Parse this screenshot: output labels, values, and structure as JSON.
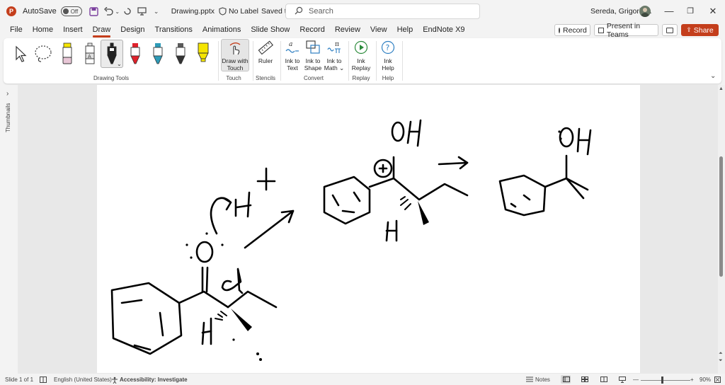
{
  "titlebar": {
    "autosave_label": "AutoSave",
    "autosave_state": "Off",
    "filename": "Drawing.pptx",
    "sensitivity": "No Label",
    "save_status": "Saved to this PC",
    "search_placeholder": "Search",
    "user_name": "Sereda, Grigoriy A"
  },
  "menu": {
    "tabs": [
      "File",
      "Home",
      "Insert",
      "Draw",
      "Design",
      "Transitions",
      "Animations",
      "Slide Show",
      "Record",
      "Review",
      "View",
      "Help",
      "EndNote X9"
    ],
    "active_tab": "Draw",
    "record_button": "Record",
    "present_button": "Present in Teams",
    "share_button": "Share"
  },
  "ribbon": {
    "groups": {
      "drawing_tools": "Drawing Tools",
      "touch": "Touch",
      "stencils": "Stencils",
      "convert": "Convert",
      "replay": "Replay",
      "help": "Help"
    },
    "draw_with_touch": [
      "Draw with",
      "Touch"
    ],
    "ruler": "Ruler",
    "ink_to_text": [
      "Ink to",
      "Text"
    ],
    "ink_to_shape": [
      "Ink to",
      "Shape"
    ],
    "ink_to_math": [
      "Ink to",
      "Math"
    ],
    "ink_replay": [
      "Ink",
      "Replay"
    ],
    "ink_help": [
      "Ink",
      "Help"
    ],
    "pen_colors": [
      "#e8c6d6",
      "#ffffff",
      "#222222",
      "#e0212b",
      "#2e9bb8",
      "#5a5a5a",
      "#f5e500"
    ]
  },
  "side": {
    "thumbnails_label": "Thumbnails"
  },
  "status": {
    "slide_info": "Slide 1 of 1",
    "language": "English (United States)",
    "accessibility": "Accessibility: Investigate",
    "notes": "Notes",
    "zoom": "90%"
  }
}
